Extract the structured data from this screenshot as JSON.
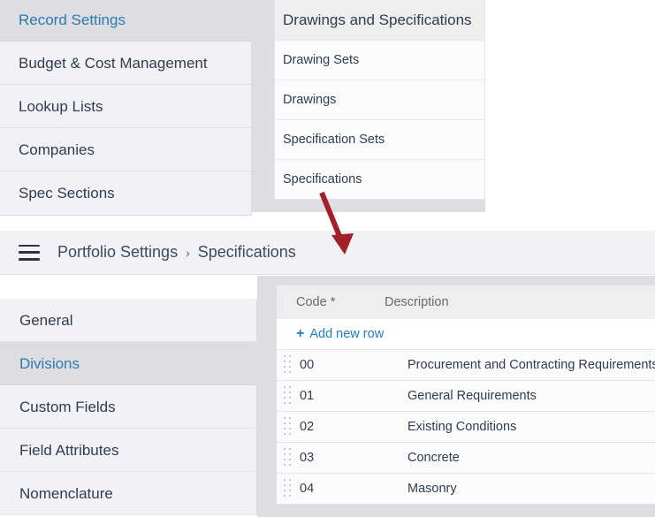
{
  "primary_menu": {
    "header": "Record Settings",
    "items": [
      {
        "label": "Budget & Cost Management"
      },
      {
        "label": "Lookup Lists"
      },
      {
        "label": "Companies"
      },
      {
        "label": "Spec Sections"
      }
    ]
  },
  "secondary_menu": {
    "header": "Drawings and Specifications",
    "items": [
      {
        "label": "Drawing Sets"
      },
      {
        "label": "Drawings"
      },
      {
        "label": "Specification Sets"
      },
      {
        "label": "Specifications"
      }
    ]
  },
  "annotation": {
    "arrow_color": "#a41f27",
    "arrow_name": "red-callout-arrow"
  },
  "breadcrumb": {
    "menu_icon": "hamburger-icon",
    "root": "Portfolio Settings",
    "separator": "›",
    "current": "Specifications"
  },
  "settings_nav": {
    "items": [
      {
        "label": "General",
        "selected": false
      },
      {
        "label": "Divisions",
        "selected": true
      },
      {
        "label": "Custom Fields",
        "selected": false
      },
      {
        "label": "Field Attributes",
        "selected": false
      },
      {
        "label": "Nomenclature",
        "selected": false
      }
    ],
    "selected_color": "#2a7ab0"
  },
  "grid": {
    "columns": [
      {
        "label": "Code *"
      },
      {
        "label": "Description"
      }
    ],
    "add_row": {
      "plus": "+",
      "label": "Add new row",
      "color": "#1d7ec6"
    },
    "rows": [
      {
        "code": "00",
        "description": "Procurement and Contracting Requirements"
      },
      {
        "code": "01",
        "description": "General Requirements"
      },
      {
        "code": "02",
        "description": "Existing Conditions"
      },
      {
        "code": "03",
        "description": "Concrete"
      },
      {
        "code": "04",
        "description": "Masonry"
      }
    ]
  }
}
